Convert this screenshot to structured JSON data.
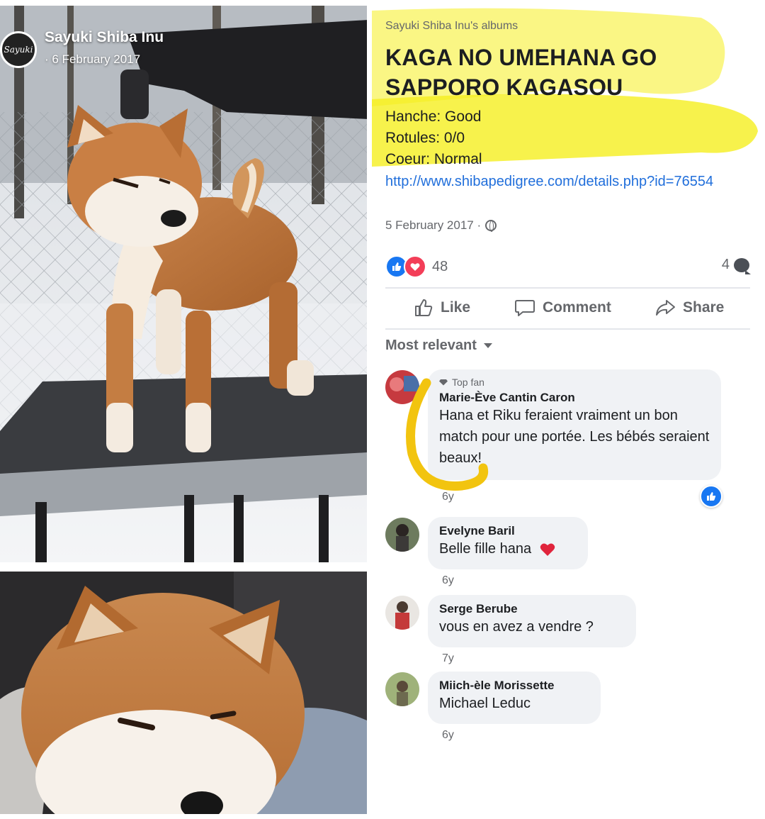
{
  "post": {
    "page_name": "Sayuki Shiba Inu",
    "page_logo_text": "Sayuki",
    "photo_date": "· 6 February 2017"
  },
  "album": {
    "albums_link": "Sayuki Shiba Inu's albums",
    "title": "KAGA NO UMEHANA GO SAPPORO KAGASOU",
    "hanche": "Hanche: Good",
    "rotules": "Rotules: 0/0",
    "coeur": "Coeur: Normal",
    "link": "http://www.shibapedigree.com/details.php?id=76554",
    "date": "5 February 2017 ·"
  },
  "stats": {
    "reaction_count": "48",
    "comment_count": "4"
  },
  "actions": {
    "like": "Like",
    "comment": "Comment",
    "share": "Share"
  },
  "sort_label": "Most relevant",
  "comments": [
    {
      "badge": "Top fan",
      "author": "Marie-Ève Cantin Caron",
      "text": "Hana et Riku feraient vraiment un bon match pour une portée. Les bébés seraient beaux!",
      "time": "6y"
    },
    {
      "author": "Evelyne Baril",
      "text": "Belle fille hana",
      "time": "6y"
    },
    {
      "author": "Serge Berube",
      "text": "vous en avez a vendre ?",
      "time": "7y"
    },
    {
      "author": "Miich-èle Morissette",
      "text": "Michael Leduc",
      "time": "6y"
    }
  ],
  "colors": {
    "highlighter": "#f5ef1f",
    "yellow_marker": "#f2c40f",
    "like_blue": "#1877f2",
    "love_red": "#f33e58",
    "link_blue": "#216fdb"
  }
}
